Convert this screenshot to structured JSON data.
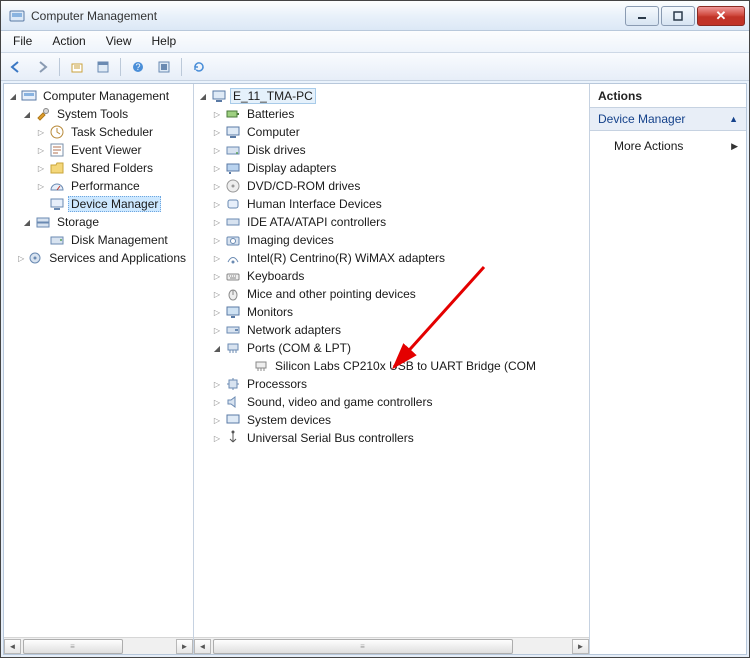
{
  "window": {
    "title": "Computer Management"
  },
  "menus": {
    "file": "File",
    "action": "Action",
    "view": "View",
    "help": "Help"
  },
  "leftTree": {
    "root": "Computer Management",
    "systemTools": "System Tools",
    "taskScheduler": "Task Scheduler",
    "eventViewer": "Event Viewer",
    "sharedFolders": "Shared Folders",
    "performance": "Performance",
    "deviceManager": "Device Manager",
    "storage": "Storage",
    "diskManagement": "Disk Management",
    "services": "Services and Applications"
  },
  "centerTree": {
    "root": "E_11_TMA-PC",
    "batteries": "Batteries",
    "computer": "Computer",
    "diskDrives": "Disk drives",
    "displayAdapters": "Display adapters",
    "dvd": "DVD/CD-ROM drives",
    "hid": "Human Interface Devices",
    "ide": "IDE ATA/ATAPI controllers",
    "imaging": "Imaging devices",
    "intelWimax": "Intel(R) Centrino(R) WiMAX adapters",
    "keyboards": "Keyboards",
    "mice": "Mice and other pointing devices",
    "monitors": "Monitors",
    "netAdapters": "Network adapters",
    "ports": "Ports (COM & LPT)",
    "portsChild": "Silicon Labs CP210x USB to UART Bridge (COM",
    "processors": "Processors",
    "sound": "Sound, video and game controllers",
    "sysDevices": "System devices",
    "usb": "Universal Serial Bus controllers"
  },
  "actions": {
    "header": "Actions",
    "section": "Device Manager",
    "more": "More Actions"
  }
}
